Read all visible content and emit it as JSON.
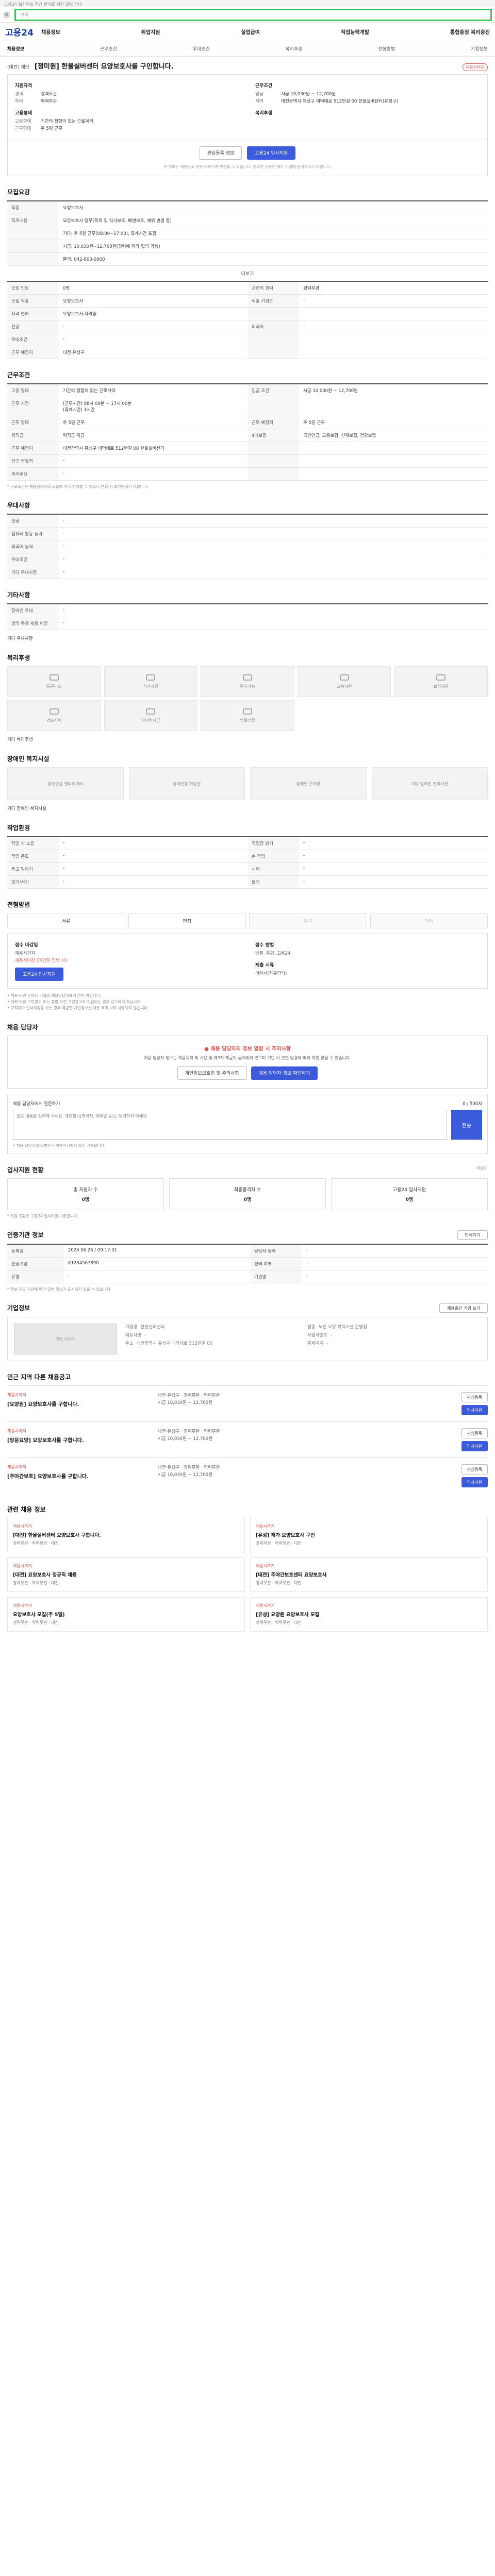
{
  "topbar": {
    "text": "고용24 웹사이트 접근 편의를 위한 알림 안내"
  },
  "search": {
    "placeholder": "구직"
  },
  "gnb": {
    "logo": "고용24",
    "menu": [
      "채용정보",
      "취업지원",
      "실업급여",
      "직업능력개발",
      "통합증정 복리증진"
    ]
  },
  "tabs": [
    "채용정보",
    "근무조건",
    "우대조건",
    "복리후생",
    "전형방법",
    "기업정보"
  ],
  "header": {
    "company": "(대전) 재단",
    "title": "[정미원] 한울실버센터 요양보호사를 구인합니다.",
    "badge": "채용시마감"
  },
  "summary": {
    "left_title": "지원자격",
    "left": [
      {
        "k": "경력",
        "v": "경력무관"
      },
      {
        "k": "학력",
        "v": "학력무관"
      }
    ],
    "left_title2": "고용형태",
    "left2": [
      {
        "k": "고용형태",
        "v": "기간의 정함이 없는 근로계약"
      },
      {
        "k": "근무형태",
        "v": "주 5일 근무"
      }
    ],
    "right_title": "근무조건",
    "right": [
      {
        "k": "임금",
        "v": "시급 10,030원 ~ 12,700원"
      },
      {
        "k": "지역",
        "v": "대전광역시 유성구 대덕대로 512번길 00 한울실버센터(유성구)"
      }
    ],
    "right_title2": "복리후생"
  },
  "actions": {
    "scrap": "관심등록 정보",
    "apply": "고용24 입사지원",
    "note": "위 정보는 채용공고 원문 내용이며 변경될 수 있습니다. 정확한 내용은 해당 기업에 문의하시기 바랍니다."
  },
  "sec_jobinfo": {
    "title": "모집요강",
    "rows": [
      [
        "직종",
        "요양보호사"
      ],
      [
        "직무내용",
        "요양보호사 업무(목욕 및 식사보조, 배변보조, 체위 변경 등)"
      ],
      [
        "",
        "기타: 주 5일 근무(08:00~17:00), 휴게시간 포함"
      ],
      [
        "",
        "시급: 10,030원~12,700원(경력에 따라 협의 가능)"
      ],
      [
        "",
        "문의: 042-000-0000"
      ]
    ],
    "more": "더보기",
    "grid": [
      [
        "모집 인원",
        "0명",
        "관련직 경력",
        "경력무관"
      ],
      [
        "모집 직종",
        "요양보호사",
        "직종 키워드",
        "-"
      ],
      [
        "자격 면허",
        "요양보호사 자격증",
        "",
        ""
      ],
      [
        "전공",
        "-",
        "외국어",
        "-"
      ],
      [
        "우대조건",
        "-",
        "",
        ""
      ],
      [
        "근무 예정지",
        "대전 유성구",
        "",
        ""
      ]
    ]
  },
  "sec_work": {
    "title": "근무조건",
    "rows": [
      [
        "고용 형태",
        "기간의 정함이 없는 근로계약",
        "임금 조건",
        "시급 10,030원 ~ 12,700원"
      ],
      [
        "근무 시간",
        "(근무시간) 08시 00분 ~ 17시 00분\n(휴게시간) 1시간",
        "",
        ""
      ],
      [
        "근무 형태",
        "주 5일 근무",
        "근무 예정지",
        "주 5일 근무"
      ],
      [
        "퇴직금",
        "퇴직금 지급",
        "4대보험",
        "국민연금, 고용보험, 산재보험, 건강보험"
      ],
      [
        "근무 예정지",
        "대전광역시 유성구 대덕대로 512번길 00 한울실버센터",
        "",
        ""
      ],
      [
        "인근 전철역",
        "-",
        "",
        ""
      ],
      [
        "복리후생",
        "-",
        "",
        ""
      ]
    ],
    "note": "* 근로조건은 채용담당자의 조율에 따라 변경될 수 있으니 면접 시 확인하시기 바랍니다."
  },
  "sec_pref": {
    "title": "우대사항",
    "rows": [
      [
        "전공",
        "-"
      ],
      [
        "컴퓨터 활용 능력",
        "-"
      ],
      [
        "외국어 능력",
        "-"
      ],
      [
        "우대조건",
        "-"
      ],
      [
        "기타 우대사항",
        "-"
      ]
    ]
  },
  "sec_etc": {
    "title": "기타사항",
    "rows": [
      [
        "장애인 우대",
        "-"
      ],
      [
        "병역 특례 채용 희망",
        "-"
      ]
    ],
    "other_label": "기타 우대사항"
  },
  "sec_welfare": {
    "title": "복리후생",
    "tiles": [
      "통근버스",
      "식사제공",
      "주차가능",
      "교육지원",
      "보험제공",
      "경조사비",
      "자녀학자금",
      "명절선물"
    ],
    "etc_label": "기타 복리후생"
  },
  "sec_disabled": {
    "title": "장애인 복지시설",
    "tiles": [
      "장애인용 엘리베이터",
      "장애인용 화장실",
      "장애인 주차장",
      "기타 장애인 편의시설"
    ],
    "etc_label": "기타 장애인 복지시설"
  },
  "sec_env": {
    "title": "작업환경",
    "rows": [
      [
        "작업 시 소음",
        "-",
        "작업장 밝기",
        "-"
      ],
      [
        "작업 온도",
        "-",
        "손 작업",
        "-"
      ],
      [
        "듣고 말하기",
        "-",
        "시력",
        "-"
      ],
      [
        "앉기/서기",
        "-",
        "들기",
        "-"
      ]
    ]
  },
  "sec_process": {
    "title": "전형방법",
    "steps": [
      "서류",
      "면접",
      "필기",
      "기타"
    ],
    "apply_label": "접수 마감일",
    "apply_value": "채용시까지",
    "apply_red": "채용시마감 (마감일 임박 시)",
    "apply_btn": "고용24 입사지원",
    "method_label": "접수 방법",
    "method_value": "방문, 우편, 고용24",
    "doc_label": "제출 서류",
    "doc_value": "이력서(자유양식)",
    "bullets": [
      "• 채용 관련 문의는 기업의 채용담당자에게 연락 바랍니다.",
      "• 허위·과장 구인광고 또는 불법 파견 구인광고로 의심되는 경우 신고하여 주십시오.",
      "• 구직자가 입사지원을 하는 경우 제공한 개인정보는 채용 목적 이외 사용되지 않습니다."
    ]
  },
  "sec_safe": {
    "title": "채용 담당자",
    "warn": "채용 담당자의 정보 열람 시 주의사항",
    "desc": "채용 담당자 정보는 채용목적 외 사용 및 제3자 제공이 금지되어 있으며 위반 시 관련 법령에 따라 처벌 받을 수 있습니다.",
    "btn1": "개인정보보호법 및 주의사항",
    "btn2": "채용 담당자 정보 확인하기",
    "qna_title": "채용 담당자에게 질문하기",
    "qna_count": "0 / 500자",
    "qna_placeholder": "질문 내용을 입력해 주세요. 개인정보(연락처, 이메일 등)는 입력하지 마세요.",
    "qna_send": "전송",
    "qna_notes": "• 채용 담당자의 답변은 마이페이지에서 확인 가능합니다."
  },
  "sec_stats": {
    "title": "입사지원 현황",
    "more": "더보기",
    "cards": [
      {
        "t": "총 지원자 수",
        "n": "0명"
      },
      {
        "t": "최종합격자 수",
        "n": "0명"
      },
      {
        "t": "고용24 입사지원",
        "n": "0명"
      }
    ],
    "note": "* 지원 현황은 고용24 입사지원 기준입니다."
  },
  "sec_info": {
    "title": "인증기관 정보",
    "print": "인쇄하기",
    "rows": [
      [
        "등록일",
        "2024.06.26 / 09:17:31",
        "담당자 등록",
        "-"
      ],
      [
        "인증기업",
        "K1234567890",
        "선택 여부",
        "-"
      ],
      [
        "유형",
        "-",
        "기관명",
        "-"
      ]
    ],
    "note": "* 정보 제공 기관에 따라 일부 정보가 표시되지 않을 수 있습니다."
  },
  "sec_org": {
    "title": "기업정보",
    "btn": "채용중인 기업 보기",
    "img": "기업 이미지",
    "kvs": [
      [
        "기업명",
        "한울실버센터"
      ],
      [
        "업종",
        "노인 요양 복지시설 운영업"
      ],
      [
        "대표자명",
        "-"
      ],
      [
        "사업자번호",
        "-"
      ],
      [
        "주소",
        "대전광역시 유성구 대덕대로 512번길 00"
      ],
      [
        "홈페이지",
        "-"
      ]
    ]
  },
  "sec_jobs": {
    "title": "인근 지역 다른 채용공고",
    "items": [
      {
        "lab": "채용시까지",
        "title": "[요양원] 요양보호사를 구합니다.",
        "meta": "대전 유성구 · 경력무관 · 학력무관\n시급 10,030원 ~ 12,700원",
        "b1": "관심등록",
        "b2": "입사지원"
      },
      {
        "lab": "채용시까지",
        "title": "[방문요양] 요양보호사를 구합니다.",
        "meta": "대전 유성구 · 경력무관 · 학력무관\n시급 10,030원 ~ 12,700원",
        "b1": "관심등록",
        "b2": "입사지원"
      },
      {
        "lab": "채용시까지",
        "title": "[주야간보호] 요양보호사를 구합니다.",
        "meta": "대전 유성구 · 경력무관 · 학력무관\n시급 10,030원 ~ 12,700원",
        "b1": "관심등록",
        "b2": "입사지원"
      }
    ]
  },
  "sec_news": {
    "title": "관련 채용 정보",
    "items": [
      {
        "lab": "채용시까지",
        "t": "[대전] 한울실버센터 요양보호사 구합니다.",
        "m": "경력무관 · 학력무관 · 대전"
      },
      {
        "lab": "채용시까지",
        "t": "[유성] 재가 요양보호사 구인",
        "m": "경력무관 · 학력무관 · 대전"
      },
      {
        "lab": "채용시까지",
        "t": "[대전] 요양보호사 정규직 채용",
        "m": "경력무관 · 학력무관 · 대전"
      },
      {
        "lab": "채용시까지",
        "t": "[대전] 주야간보호센터 요양보호사",
        "m": "경력무관 · 학력무관 · 대전"
      },
      {
        "lab": "채용시까지",
        "t": "요양보호사 모집(주 5일)",
        "m": "경력무관 · 학력무관 · 대전"
      },
      {
        "lab": "채용시까지",
        "t": "[유성] 요양원 요양보호사 모집",
        "m": "경력무관 · 학력무관 · 대전"
      }
    ]
  }
}
